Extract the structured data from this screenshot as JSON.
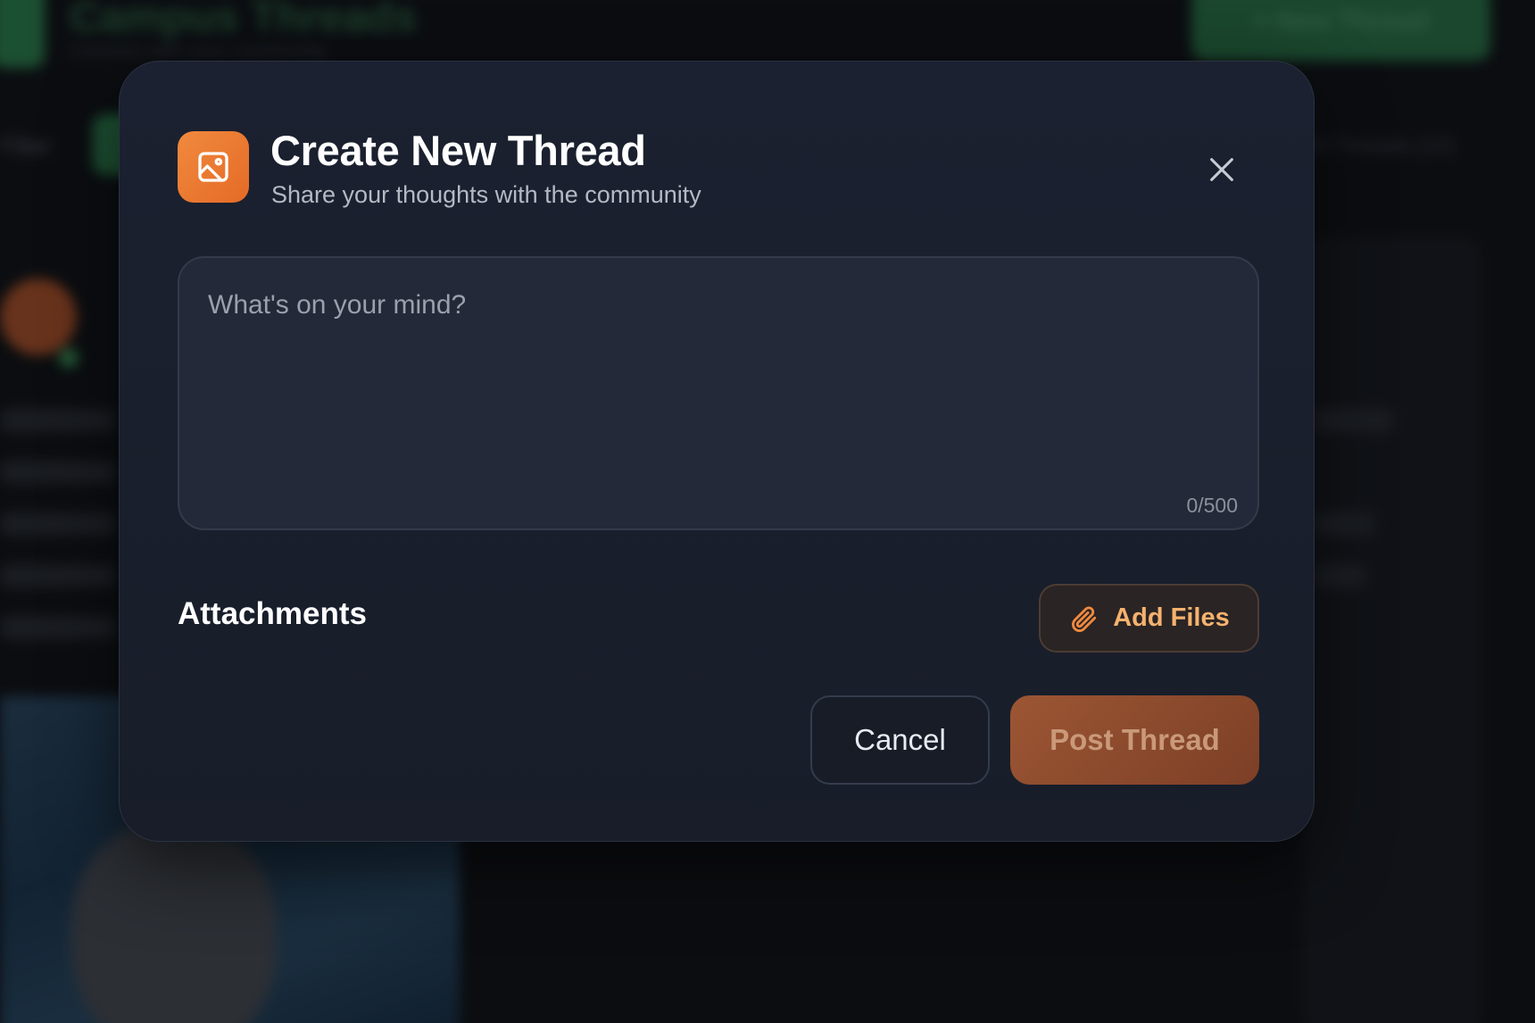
{
  "background": {
    "app_title": "Campus Threads",
    "app_subtitle": "Connect with your community",
    "new_thread_label": "+  New Thread",
    "filter_label": "Filter",
    "thread_count": "All Threads (10)"
  },
  "modal": {
    "title": "Create New Thread",
    "subtitle": "Share your thoughts with the community",
    "header_icon": "image-icon",
    "close_icon": "close-icon",
    "composer": {
      "value": "",
      "placeholder": "What's on your mind?",
      "char_count": "0/500"
    },
    "attachments": {
      "label": "Attachments",
      "add_files_label": "Add Files",
      "add_files_icon": "paperclip-icon"
    },
    "actions": {
      "cancel_label": "Cancel",
      "post_label": "Post Thread"
    }
  },
  "colors": {
    "accent": "#e97a33",
    "modal_bg": "#1b2130",
    "post_button": "#8f4c2e",
    "add_files_text": "#f6b26e"
  }
}
